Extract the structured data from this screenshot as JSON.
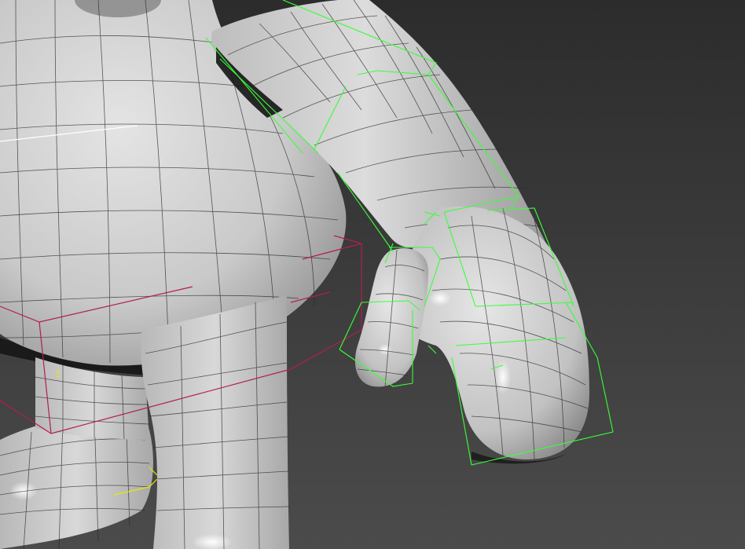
{
  "viewport": {
    "background_top": "#2f2f2f",
    "background_bottom": "#4a4a4a",
    "mesh_color": "#cfcfcf",
    "wire_color": "#2a2a2a"
  },
  "gizmos": {
    "selection_color": "#39ff39",
    "bounding_box_color": "#b0204a",
    "axis_color": "#e8e800",
    "text_marker": "I"
  }
}
